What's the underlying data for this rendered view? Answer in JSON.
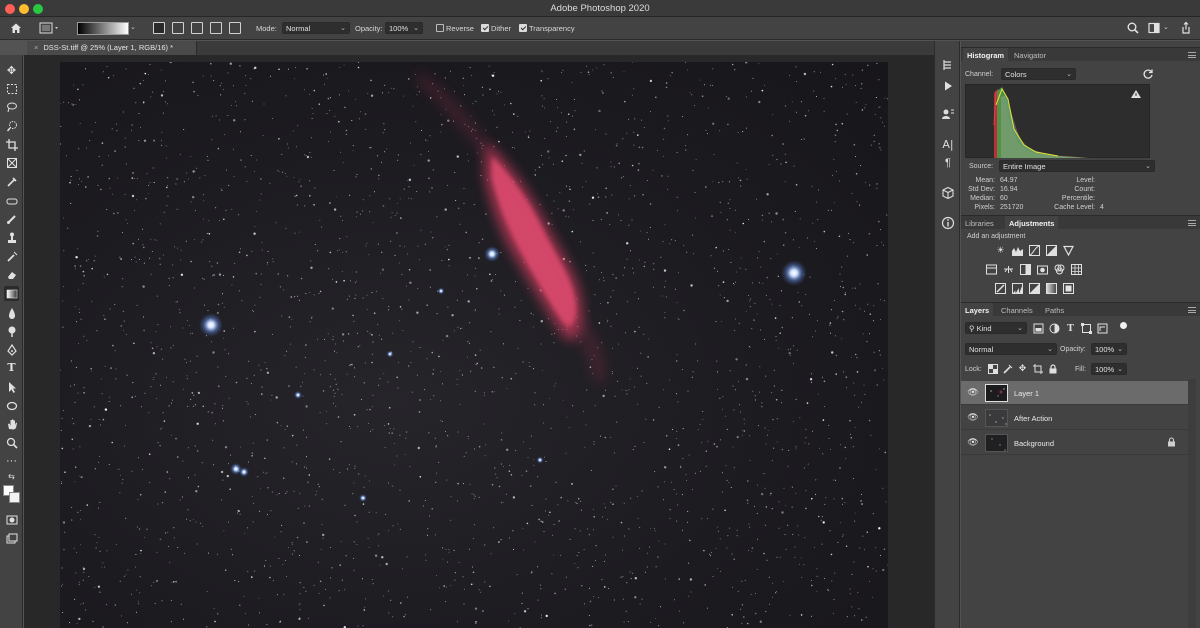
{
  "window": {
    "title": "Adobe Photoshop 2020"
  },
  "options_bar": {
    "mode_label": "Mode:",
    "mode_value": "Normal",
    "opacity_label": "Opacity:",
    "opacity_value": "100%",
    "reverse_label": "Reverse",
    "reverse_checked": false,
    "dither_label": "Dither",
    "dither_checked": true,
    "transparency_label": "Transparency",
    "transparency_checked": true
  },
  "document": {
    "tab_title": "DSS-St.tiff @ 25% (Layer 1, RGB/16) *"
  },
  "histogram_panel": {
    "tabs": [
      "Histogram",
      "Navigator"
    ],
    "active_tab": "Histogram",
    "channel_label": "Channel:",
    "channel_value": "Colors",
    "source_label": "Source:",
    "source_value": "Entire Image",
    "stats_left": [
      {
        "key": "Mean:",
        "value": "64.97"
      },
      {
        "key": "Std Dev:",
        "value": "16.94"
      },
      {
        "key": "Median:",
        "value": "60"
      },
      {
        "key": "Pixels:",
        "value": "251720"
      }
    ],
    "stats_right": [
      {
        "key": "Level:",
        "value": ""
      },
      {
        "key": "Count:",
        "value": ""
      },
      {
        "key": "Percentile:",
        "value": ""
      },
      {
        "key": "Cache Level:",
        "value": "4"
      }
    ]
  },
  "adjustments_panel": {
    "tabs": [
      "Libraries",
      "Adjustments"
    ],
    "active_tab": "Adjustments",
    "hint": "Add an adjustment"
  },
  "layers_panel": {
    "tabs": [
      "Layers",
      "Channels",
      "Paths"
    ],
    "active_tab": "Layers",
    "filter_value": "Kind",
    "blend_mode": "Normal",
    "opacity_label": "Opacity:",
    "opacity_value": "100%",
    "lock_label": "Lock:",
    "fill_label": "Fill:",
    "fill_value": "100%",
    "layers": [
      {
        "name": "Layer 1",
        "selected": true,
        "locked": false
      },
      {
        "name": "After Action",
        "selected": false,
        "locked": false
      },
      {
        "name": "Background",
        "selected": false,
        "locked": true
      }
    ]
  },
  "colors": {
    "accent_green": "#28c840",
    "close_red": "#ff5f57",
    "minimize_yellow": "#febc2e",
    "nebula_red": "#c23a5c",
    "star_blue": "#9ec4ff"
  }
}
